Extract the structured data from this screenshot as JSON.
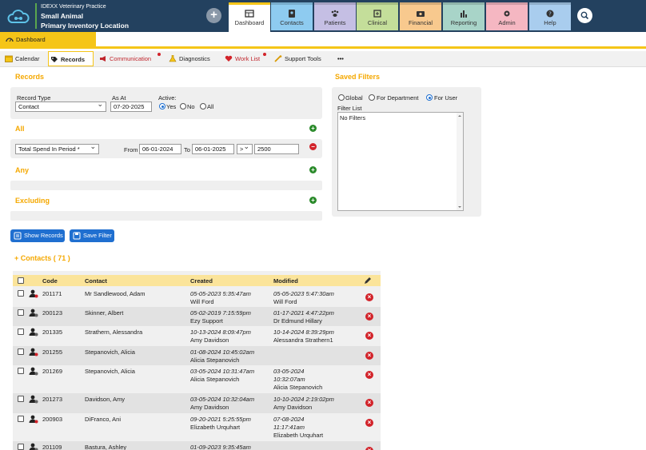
{
  "header": {
    "brand_line1": "IDEXX Veterinary Practice",
    "brand_line2": "Small Animal",
    "brand_line3": "Primary Inventory Location",
    "add_symbol": "+",
    "tabs": [
      {
        "label": "Dashboard",
        "color": "#ffffff",
        "icon": "dashboard-icon"
      },
      {
        "label": "Contacts",
        "color": "#8ecbf0",
        "icon": "contacts-icon"
      },
      {
        "label": "Patients",
        "color": "#c5bfe4",
        "icon": "paw-icon"
      },
      {
        "label": "Clinical",
        "color": "#c4de9a",
        "icon": "clinical-icon"
      },
      {
        "label": "Financial",
        "color": "#f8c98e",
        "icon": "money-icon"
      },
      {
        "label": "Reporting",
        "color": "#a8d4c8",
        "icon": "bar-chart-icon"
      },
      {
        "label": "Admin",
        "color": "#f5b7c2",
        "icon": "gear-icon"
      },
      {
        "label": "Help",
        "color": "#a9cdee",
        "icon": "question-icon"
      }
    ]
  },
  "dashboard_tab": "Dashboard",
  "subnav": [
    {
      "label": "Calendar",
      "icon": "calendar-icon"
    },
    {
      "label": "Records",
      "icon": "records-icon"
    },
    {
      "label": "Communication",
      "icon": "megaphone-icon"
    },
    {
      "label": "Diagnostics",
      "icon": "diagnostics-icon"
    },
    {
      "label": "Work List",
      "icon": "heart-icon"
    },
    {
      "label": "Support Tools",
      "icon": "tools-icon"
    },
    {
      "label": "•••",
      "icon": "more-icon"
    }
  ],
  "records": {
    "title": "Records",
    "record_type_label": "Record Type",
    "record_type_value": "Contact",
    "as_at_label": "As At",
    "as_at_value": "07-20-2025",
    "active_label": "Active:",
    "active_options": [
      "Yes",
      "No",
      "All"
    ],
    "all_title": "All",
    "condition_field": "Total Spend In Period *",
    "from_label": "From",
    "from_value": "06-01-2024",
    "to_label": "To",
    "to_value": "06-01-2025",
    "operator": ">",
    "amount": "2500",
    "any_title": "Any",
    "excluding_title": "Excluding",
    "add_symbol": "+",
    "remove_symbol": "−"
  },
  "saved_filters": {
    "title": "Saved Filters",
    "scope_options": [
      "Global",
      "For Department",
      "For User"
    ],
    "list_label": "Filter List",
    "list_empty": "No Filters"
  },
  "buttons": {
    "show_records": "Show Records",
    "save_filter": "Save Filter"
  },
  "contacts": {
    "title": "Contacts ( 71 )",
    "expand_symbol": "+",
    "headers": {
      "code": "Code",
      "contact": "Contact",
      "created": "Created",
      "modified": "Modified"
    },
    "delete_symbol": "×",
    "rows": [
      {
        "code": "201171",
        "contact": "Mr Sandlewood, Adam",
        "created_date": "05-05-2023 5:35:47am",
        "created_by": "Will Ford",
        "modified_date": "05-05-2023 5:47:30am",
        "modified_by": "Will Ford",
        "modified_extra": ""
      },
      {
        "code": "200123",
        "contact": "Skinner, Albert",
        "created_date": "05-02-2019 7:15:59pm",
        "created_by": "Ezy Support",
        "modified_date": "01-17-2021 4:47:22pm",
        "modified_by": "Dr Edmund Hillary",
        "modified_extra": ""
      },
      {
        "code": "201335",
        "contact": "Strathern, Alessandra",
        "created_date": "10-13-2024 8:09:47pm",
        "created_by": "Amy Davidson",
        "modified_date": "10-14-2024 8:39:29pm",
        "modified_by": "Alessandra Strathern1",
        "modified_extra": ""
      },
      {
        "code": "201255",
        "contact": "Stepanovich, Alicia",
        "created_date": "01-08-2024 10:45:02am",
        "created_by": "Alicia Stepanovich",
        "modified_date": "",
        "modified_by": "",
        "modified_extra": ""
      },
      {
        "code": "201269",
        "contact": "Stepanovich, Alicia",
        "created_date": "03-05-2024 10:31:47am",
        "created_by": "Alicia Stepanovich",
        "modified_date": "03-05-2024",
        "modified_by": "10:32:07am",
        "modified_extra": "Alicia Stepanovich"
      },
      {
        "code": "201273",
        "contact": "Davidson, Amy",
        "created_date": "03-05-2024 10:32:04am",
        "created_by": "Amy Davidson",
        "modified_date": "10-10-2024 2:19:02pm",
        "modified_by": "Amy Davidson",
        "modified_extra": ""
      },
      {
        "code": "200903",
        "contact": "DiFranco, Ani",
        "created_date": "09-20-2021 5:25:55pm",
        "created_by": "Elizabeth Urquhart",
        "modified_date": "07-08-2024",
        "modified_by": "11:17:41am",
        "modified_extra": "Elizabeth Urquhart"
      },
      {
        "code": "201109",
        "contact": "Bastura, Ashley",
        "created_date": "01-09-2023 9:35:45am",
        "created_by": "",
        "modified_date": "",
        "modified_by": "",
        "modified_extra": ""
      }
    ]
  }
}
